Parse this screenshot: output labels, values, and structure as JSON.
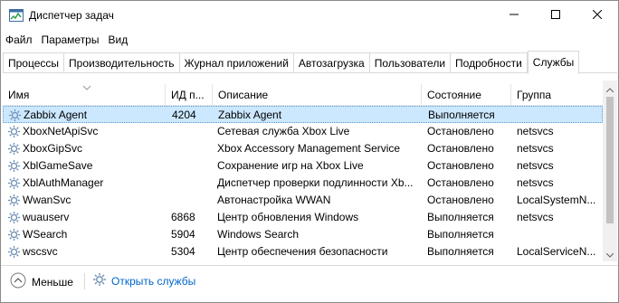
{
  "window": {
    "title": "Диспетчер задач"
  },
  "menu": [
    "Файл",
    "Параметры",
    "Вид"
  ],
  "tabs": [
    {
      "label": "Процессы",
      "active": false
    },
    {
      "label": "Производительность",
      "active": false
    },
    {
      "label": "Журнал приложений",
      "active": false
    },
    {
      "label": "Автозагрузка",
      "active": false
    },
    {
      "label": "Пользователи",
      "active": false
    },
    {
      "label": "Подробности",
      "active": false
    },
    {
      "label": "Службы",
      "active": true
    }
  ],
  "columns": {
    "name": "Имя",
    "pid": "ИД п...",
    "desc": "Описание",
    "state": "Состояние",
    "group": "Группа"
  },
  "rows": [
    {
      "name": "Zabbix Agent",
      "pid": "4204",
      "desc": "Zabbix Agent",
      "state": "Выполняется",
      "group": "",
      "selected": true
    },
    {
      "name": "XboxNetApiSvc",
      "pid": "",
      "desc": "Сетевая служба Xbox Live",
      "state": "Остановлено",
      "group": "netsvcs",
      "selected": false
    },
    {
      "name": "XboxGipSvc",
      "pid": "",
      "desc": "Xbox Accessory Management Service",
      "state": "Остановлено",
      "group": "netsvcs",
      "selected": false
    },
    {
      "name": "XblGameSave",
      "pid": "",
      "desc": "Сохранение игр на Xbox Live",
      "state": "Остановлено",
      "group": "netsvcs",
      "selected": false
    },
    {
      "name": "XblAuthManager",
      "pid": "",
      "desc": "Диспетчер проверки подлинности Xb...",
      "state": "Остановлено",
      "group": "netsvcs",
      "selected": false
    },
    {
      "name": "WwanSvc",
      "pid": "",
      "desc": "Автонастройка WWAN",
      "state": "Остановлено",
      "group": "LocalSystemN...",
      "selected": false
    },
    {
      "name": "wuauserv",
      "pid": "6868",
      "desc": "Центр обновления Windows",
      "state": "Выполняется",
      "group": "netsvcs",
      "selected": false
    },
    {
      "name": "WSearch",
      "pid": "5904",
      "desc": "Windows Search",
      "state": "Выполняется",
      "group": "",
      "selected": false
    },
    {
      "name": "wscsvc",
      "pid": "5304",
      "desc": "Центр обеспечения безопасности",
      "state": "Выполняется",
      "group": "LocalServiceN...",
      "selected": false
    }
  ],
  "footer": {
    "fewer_label": "Меньше",
    "open_services_label": "Открыть службы"
  },
  "colors": {
    "selection": "#cce8ff",
    "link": "#0066cc",
    "accent": "#5b9bd5"
  }
}
